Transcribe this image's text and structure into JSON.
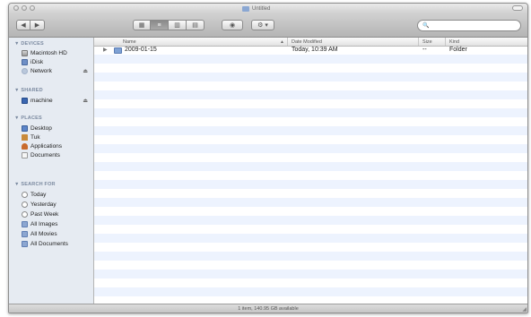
{
  "window": {
    "title": "Untitled"
  },
  "toolbar": {
    "back_glyph": "◀",
    "forward_glyph": "▶",
    "view_icons": [
      "▦",
      "≡",
      "▥",
      "▤"
    ],
    "quicklook_glyph": "◉",
    "action_glyph": "⚙ ▾",
    "search_glyph": "🔍"
  },
  "sidebar": {
    "sections": [
      {
        "title": "▼ DEVICES",
        "items": [
          {
            "label": "Macintosh HD",
            "icon": "hard-drive-icon"
          },
          {
            "label": "iDisk",
            "icon": "idisk-icon"
          },
          {
            "label": "Network",
            "icon": "network-icon",
            "eject": "⏏"
          }
        ]
      },
      {
        "title": "▼ SHARED",
        "items": [
          {
            "label": "machine",
            "icon": "shared-computer-icon",
            "eject": "⏏"
          }
        ]
      },
      {
        "title": "▼ PLACES",
        "items": [
          {
            "label": "Desktop",
            "icon": "desktop-icon"
          },
          {
            "label": "Tuk",
            "icon": "home-icon"
          },
          {
            "label": "Applications",
            "icon": "applications-icon"
          },
          {
            "label": "Documents",
            "icon": "documents-icon"
          }
        ]
      },
      {
        "title": "▼ SEARCH FOR",
        "items": [
          {
            "label": "Today",
            "icon": "clock-icon"
          },
          {
            "label": "Yesterday",
            "icon": "clock-icon"
          },
          {
            "label": "Past Week",
            "icon": "clock-icon"
          },
          {
            "label": "All Images",
            "icon": "smart-folder-icon"
          },
          {
            "label": "All Movies",
            "icon": "smart-folder-icon"
          },
          {
            "label": "All Documents",
            "icon": "smart-folder-icon"
          }
        ]
      }
    ]
  },
  "columns": {
    "name": "Name",
    "date_modified": "Date Modified",
    "size": "Size",
    "kind": "Kind",
    "sort_glyph": "▲"
  },
  "files": [
    {
      "disclosure": "▶",
      "name": "2009-01-15",
      "date_modified": "Today, 10:39 AM",
      "size": "--",
      "kind": "Folder"
    }
  ],
  "status": {
    "text": "1 item, 140.95 GB available"
  },
  "resize_glyph": "◢"
}
